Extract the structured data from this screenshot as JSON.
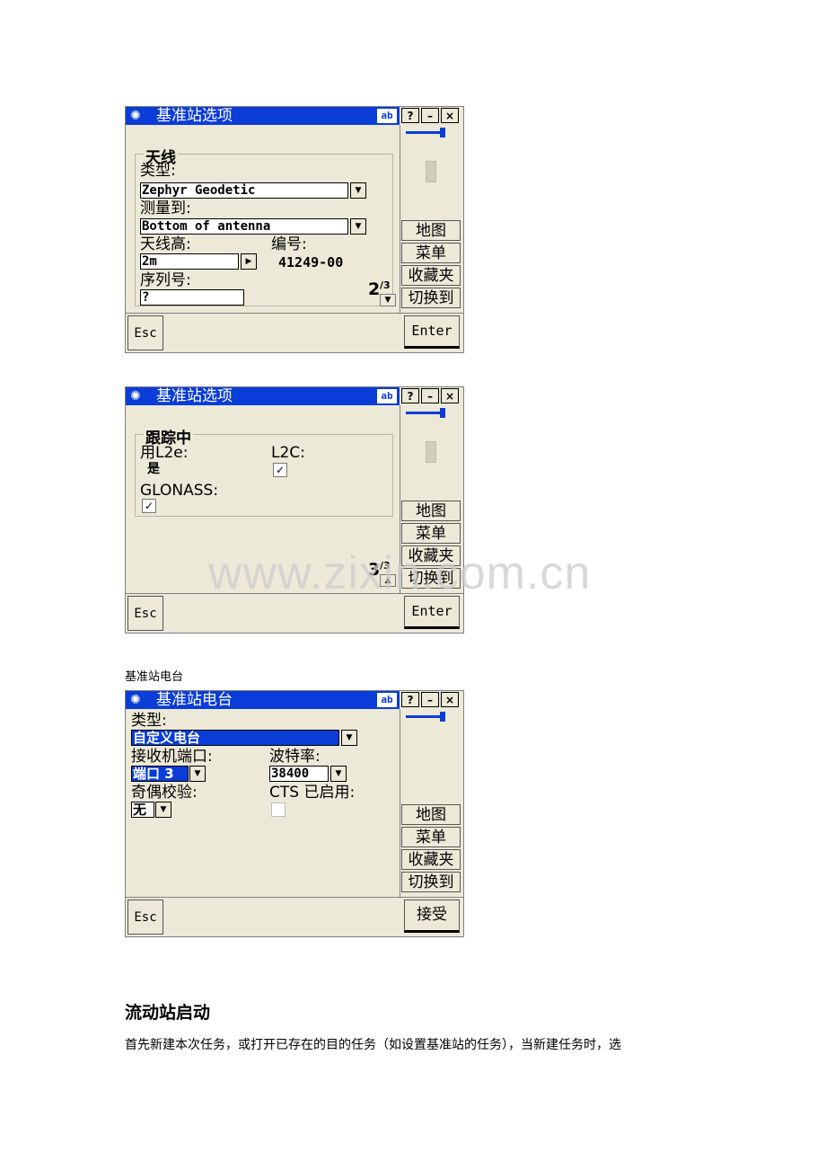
{
  "screens": [
    {
      "title": "基准站选项",
      "ab_label": "ab",
      "win_buttons": [
        "?",
        "–",
        "×"
      ],
      "side_buttons": [
        "地图",
        "菜单",
        "收藏夹",
        "切换到"
      ],
      "esc": "Esc",
      "ok": "Enter",
      "group_title": "天线",
      "type_label": "类型:",
      "type_value": "Zephyr Geodetic",
      "measure_label": "测量到:",
      "measure_value": "Bottom of antenna",
      "height_label": "天线高:",
      "height_value": "2m",
      "code_label": "编号:",
      "code_value": "41249-00",
      "serial_label": "序列号:",
      "serial_value": "?",
      "page_num": "2",
      "page_den": "/3"
    },
    {
      "title": "基准站选项",
      "ab_label": "ab",
      "win_buttons": [
        "?",
        "–",
        "×"
      ],
      "side_buttons": [
        "地图",
        "菜单",
        "收藏夹",
        "切换到"
      ],
      "esc": "Esc",
      "ok": "Enter",
      "group_title": "跟踪中",
      "l2e_label": "用L2e:",
      "l2e_value": "是",
      "l2c_label": "L2C:",
      "glonass_label": "GLONASS:",
      "page_num": "3",
      "page_den": "/3"
    },
    {
      "title": "基准站电台",
      "ab_label": "ab",
      "win_buttons": [
        "?",
        "–",
        "×"
      ],
      "side_buttons": [
        "地图",
        "菜单",
        "收藏夹",
        "切换到"
      ],
      "esc": "Esc",
      "ok": "接受",
      "type_label": "类型:",
      "type_value": "自定义电台",
      "port_label": "接收机端口:",
      "port_value": "端口 3",
      "baud_label": "波特率:",
      "baud_value": "38400",
      "parity_label": "奇偶校验:",
      "parity_value": "无",
      "cts_label": "CTS  已启用:"
    }
  ],
  "caption_radio": "基准站电台",
  "heading": "流动站启动",
  "paragraph": "首先新建本次任务，或打开已存在的目的任务（如设置基准站的任务），当新建任务时，选",
  "watermark": "www.zixin.com.cn"
}
